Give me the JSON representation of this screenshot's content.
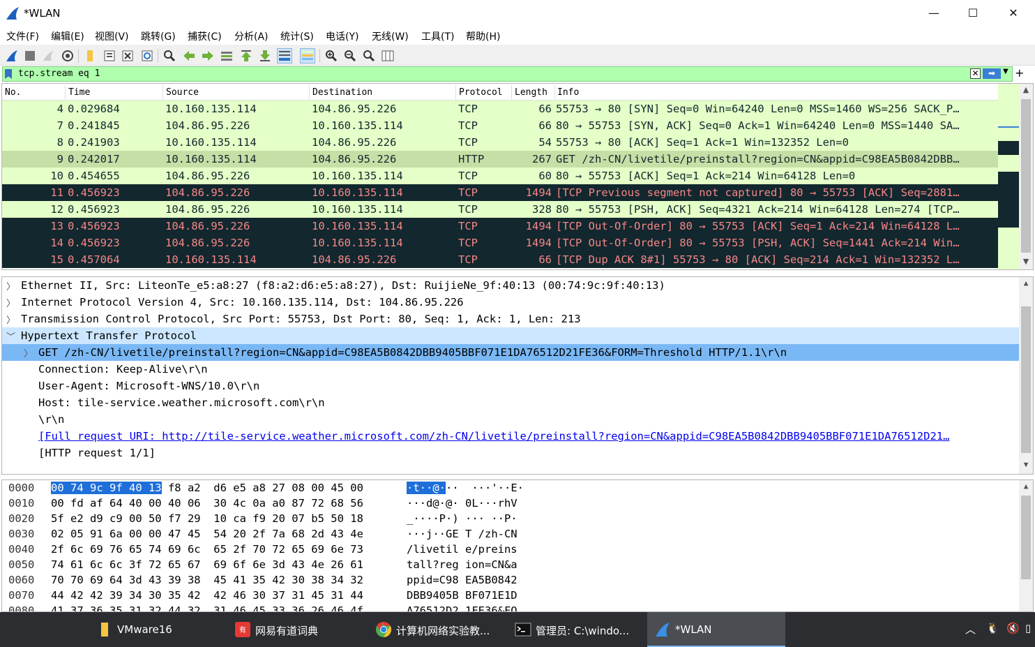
{
  "window": {
    "title": "*WLAN"
  },
  "menu": [
    "文件(F)",
    "编辑(E)",
    "视图(V)",
    "跳转(G)",
    "捕获(C)",
    "分析(A)",
    "统计(S)",
    "电话(Y)",
    "无线(W)",
    "工具(T)",
    "帮助(H)"
  ],
  "filter": {
    "value": "tcp.stream eq 1"
  },
  "columns": {
    "no": "No.",
    "time": "Time",
    "source": "Source",
    "destination": "Destination",
    "protocol": "Protocol",
    "length": "Length",
    "info": "Info"
  },
  "packets": [
    {
      "no": "4",
      "time": "0.029684",
      "src": "10.160.135.114",
      "dst": "104.86.95.226",
      "proto": "TCP",
      "len": "66",
      "info": "55753 → 80 [SYN] Seq=0 Win=64240 Len=0 MSS=1460 WS=256 SACK_P…"
    },
    {
      "no": "7",
      "time": "0.241845",
      "src": "104.86.95.226",
      "dst": "10.160.135.114",
      "proto": "TCP",
      "len": "66",
      "info": "80 → 55753 [SYN, ACK] Seq=0 Ack=1 Win=64240 Len=0 MSS=1440 SA…"
    },
    {
      "no": "8",
      "time": "0.241903",
      "src": "10.160.135.114",
      "dst": "104.86.95.226",
      "proto": "TCP",
      "len": "54",
      "info": "55753 → 80 [ACK] Seq=1 Ack=1 Win=132352 Len=0"
    },
    {
      "no": "9",
      "time": "0.242017",
      "src": "10.160.135.114",
      "dst": "104.86.95.226",
      "proto": "HTTP",
      "len": "267",
      "info": "GET /zh-CN/livetile/preinstall?region=CN&appid=C98EA5B0842DBB…"
    },
    {
      "no": "10",
      "time": "0.454655",
      "src": "104.86.95.226",
      "dst": "10.160.135.114",
      "proto": "TCP",
      "len": "60",
      "info": "80 → 55753 [ACK] Seq=1 Ack=214 Win=64128 Len=0"
    },
    {
      "no": "11",
      "time": "0.456923",
      "src": "104.86.95.226",
      "dst": "10.160.135.114",
      "proto": "TCP",
      "len": "1494",
      "info": "[TCP Previous segment not captured] 80 → 55753 [ACK] Seq=2881…"
    },
    {
      "no": "12",
      "time": "0.456923",
      "src": "104.86.95.226",
      "dst": "10.160.135.114",
      "proto": "TCP",
      "len": "328",
      "info": "80 → 55753 [PSH, ACK] Seq=4321 Ack=214 Win=64128 Len=274 [TCP…"
    },
    {
      "no": "13",
      "time": "0.456923",
      "src": "104.86.95.226",
      "dst": "10.160.135.114",
      "proto": "TCP",
      "len": "1494",
      "info": "[TCP Out-Of-Order] 80 → 55753 [ACK] Seq=1 Ack=214 Win=64128 L…"
    },
    {
      "no": "14",
      "time": "0.456923",
      "src": "104.86.95.226",
      "dst": "10.160.135.114",
      "proto": "TCP",
      "len": "1494",
      "info": "[TCP Out-Of-Order] 80 → 55753 [PSH, ACK] Seq=1441 Ack=214 Win…"
    },
    {
      "no": "15",
      "time": "0.457064",
      "src": "10.160.135.114",
      "dst": "104.86.95.226",
      "proto": "TCP",
      "len": "66",
      "info": "[TCP Dup ACK 8#1] 55753 → 80 [ACK] Seq=214 Ack=1 Win=132352 L…"
    }
  ],
  "details": [
    "Ethernet II, Src: LiteonTe_e5:a8:27 (f8:a2:d6:e5:a8:27), Dst: RuijieNe_9f:40:13 (00:74:9c:9f:40:13)",
    "Internet Protocol Version 4, Src: 10.160.135.114, Dst: 104.86.95.226",
    "Transmission Control Protocol, Src Port: 55753, Dst Port: 80, Seq: 1, Ack: 1, Len: 213",
    "Hypertext Transfer Protocol",
    "GET /zh-CN/livetile/preinstall?region=CN&appid=C98EA5B0842DBB9405BBF071E1DA76512D21FE36&FORM=Threshold HTTP/1.1\\r\\n",
    "Connection: Keep-Alive\\r\\n",
    "User-Agent: Microsoft-WNS/10.0\\r\\n",
    "Host: tile-service.weather.microsoft.com\\r\\n",
    "\\r\\n",
    "[Full request URI: http://tile-service.weather.microsoft.com/zh-CN/livetile/preinstall?region=CN&appid=C98EA5B0842DBB9405BBF071E1DA76512D21…",
    "[HTTP request 1/1]"
  ],
  "bytes": [
    {
      "off": "0000",
      "hex_sel": "00 74 9c 9f 40 13",
      "hex": " f8 a2  d6 e5 a8 27 08 00 45 00",
      "asc_sel": "·t··@·",
      "asc": "··  ···'··E·"
    },
    {
      "off": "0010",
      "hex_sel": "",
      "hex": "00 fd af 64 40 00 40 06  30 4c 0a a0 87 72 68 56",
      "asc_sel": "",
      "asc": "···d@·@· 0L···rhV"
    },
    {
      "off": "0020",
      "hex_sel": "",
      "hex": "5f e2 d9 c9 00 50 f7 29  10 ca f9 20 07 b5 50 18",
      "asc_sel": "",
      "asc": "_····P·) ··· ··P·"
    },
    {
      "off": "0030",
      "hex_sel": "",
      "hex": "02 05 91 6a 00 00 47 45  54 20 2f 7a 68 2d 43 4e",
      "asc_sel": "",
      "asc": "···j··GE T /zh-CN"
    },
    {
      "off": "0040",
      "hex_sel": "",
      "hex": "2f 6c 69 76 65 74 69 6c  65 2f 70 72 65 69 6e 73",
      "asc_sel": "",
      "asc": "/livetil e/preins"
    },
    {
      "off": "0050",
      "hex_sel": "",
      "hex": "74 61 6c 6c 3f 72 65 67  69 6f 6e 3d 43 4e 26 61",
      "asc_sel": "",
      "asc": "tall?reg ion=CN&a"
    },
    {
      "off": "0060",
      "hex_sel": "",
      "hex": "70 70 69 64 3d 43 39 38  45 41 35 42 30 38 34 32",
      "asc_sel": "",
      "asc": "ppid=C98 EA5B0842"
    },
    {
      "off": "0070",
      "hex_sel": "",
      "hex": "44 42 42 39 34 30 35 42  42 46 30 37 31 45 31 44",
      "asc_sel": "",
      "asc": "DBB9405B BF071E1D"
    },
    {
      "off": "0080",
      "hex_sel": "",
      "hex": "41 37 36 35 31 32 44 32  31 46 45 33 36 26 46 4f",
      "asc_sel": "",
      "asc": "A76512D2 1FE36&FO"
    }
  ],
  "taskbar": [
    {
      "label": "VMware16"
    },
    {
      "label": "网易有道词典"
    },
    {
      "label": "计算机网络实验教..."
    },
    {
      "label": "管理员: C:\\windo..."
    },
    {
      "label": "*WLAN"
    }
  ],
  "colors": {
    "green_row": "#e4ffc7",
    "dark_row": "#12272e",
    "dark_text": "#f78787",
    "selection": "#7ab8f5",
    "filter_bg": "#afffaf"
  }
}
